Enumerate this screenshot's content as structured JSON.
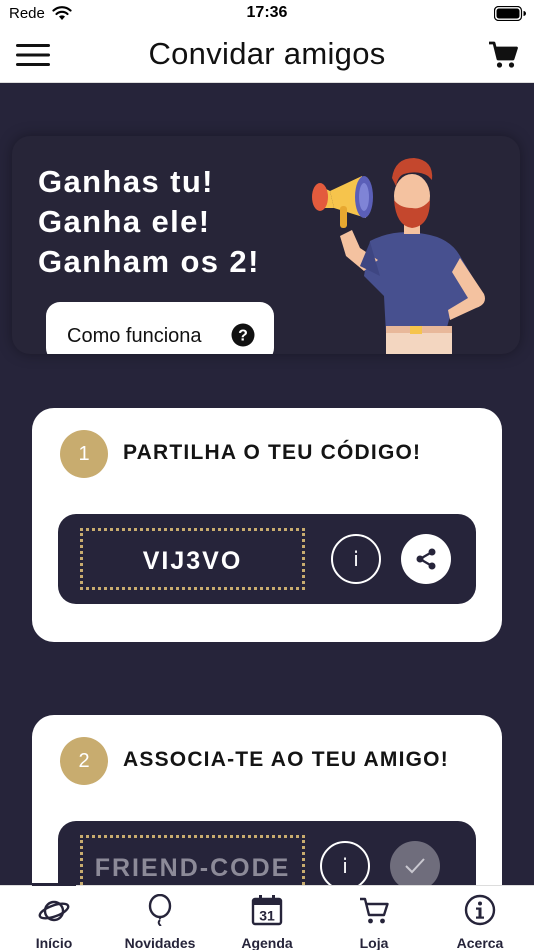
{
  "status_bar": {
    "carrier": "Rede",
    "time": "17:36"
  },
  "nav": {
    "title": "Convidar amigos",
    "menu_icon": "hamburger-menu-icon",
    "cart_icon": "shopping-cart-icon"
  },
  "hero": {
    "lines": [
      "Ganhas tu!",
      "Ganha ele!",
      "Ganham os 2!"
    ],
    "how_button_label": "Como funciona",
    "help_icon": "question-circle-icon"
  },
  "step1": {
    "number": "1",
    "title": "PARTILHA O TEU CÓDIGO!",
    "code": "VIJ3VO",
    "info_label": "i",
    "share_icon": "share-icon"
  },
  "step2": {
    "number": "2",
    "title": "ASSOCIA-TE AO TEU AMIGO!",
    "placeholder": "FRIEND-CODE",
    "info_label": "i",
    "confirm_icon": "checkmark-icon"
  },
  "tabs": [
    {
      "label": "Início",
      "icon": "planet-icon",
      "active": true
    },
    {
      "label": "Novidades",
      "icon": "balloon-icon",
      "active": false
    },
    {
      "label": "Agenda",
      "icon": "calendar-icon",
      "day": "31",
      "active": false
    },
    {
      "label": "Loja",
      "icon": "cart-icon",
      "active": false
    },
    {
      "label": "Acerca",
      "icon": "info-icon",
      "active": false
    }
  ],
  "colors": {
    "background": "#26243a",
    "accent_gold": "#c8ac6f",
    "card": "#ffffff"
  }
}
